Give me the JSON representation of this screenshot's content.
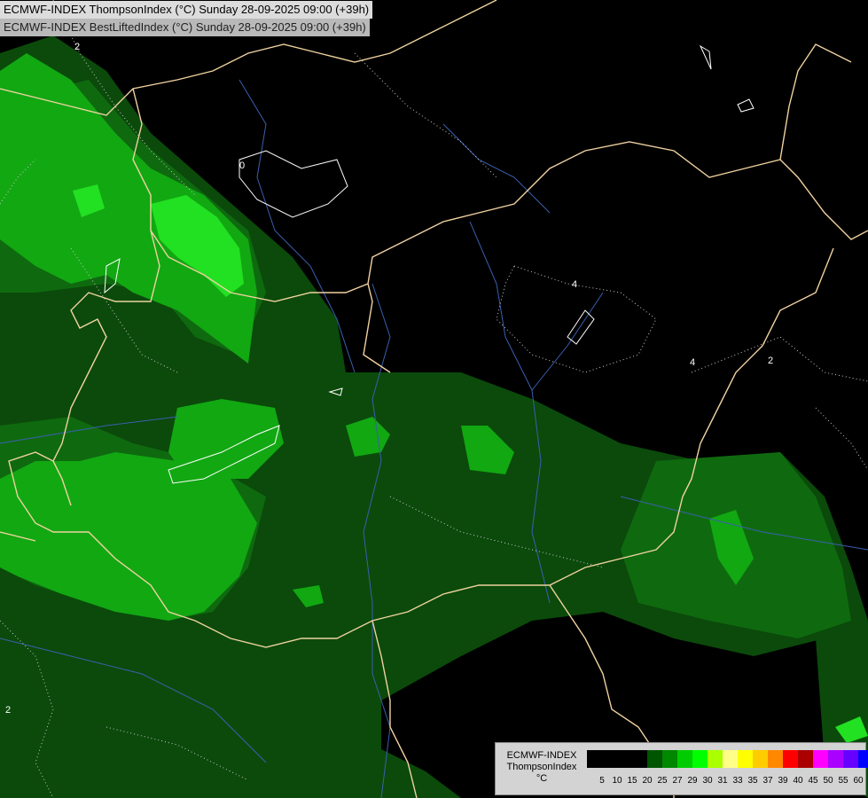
{
  "header": {
    "line1": "ECMWF-INDEX ThompsonIndex (°C) Sunday 28-09-2025 09:00 (+39h)",
    "line2": "ECMWF-INDEX BestLiftedIndex (°C) Sunday 28-09-2025 09:00 (+39h)"
  },
  "legend": {
    "line1": "ECMWF-INDEX",
    "line2": "ThompsonIndex",
    "unit": "°C",
    "colors": [
      "#000000",
      "#000000",
      "#000000",
      "#000000",
      "#005500",
      "#008800",
      "#00cc00",
      "#00ff00",
      "#aaff00",
      "#ffff88",
      "#ffff00",
      "#ffcc00",
      "#ff8800",
      "#ff0000",
      "#aa0000",
      "#ff00ff",
      "#aa00ff",
      "#6600ff",
      "#0000ff"
    ],
    "ticks": [
      "5",
      "10",
      "15",
      "20",
      "25",
      "27",
      "29",
      "30",
      "31",
      "33",
      "35",
      "37",
      "39",
      "40",
      "45",
      "50",
      "55",
      "60"
    ]
  },
  "map": {
    "contour_labels": [
      "2",
      "0",
      "4",
      "4",
      "2",
      "2"
    ],
    "colors": {
      "background": "#000000",
      "shade_dark": "#0b4a0b",
      "shade_mid": "#0f6a0f",
      "shade_light": "#12a812",
      "shade_bright": "#22e022",
      "border": "#f0d2a0",
      "river": "#3a5fb0",
      "contour": "#c8c8c8"
    }
  }
}
